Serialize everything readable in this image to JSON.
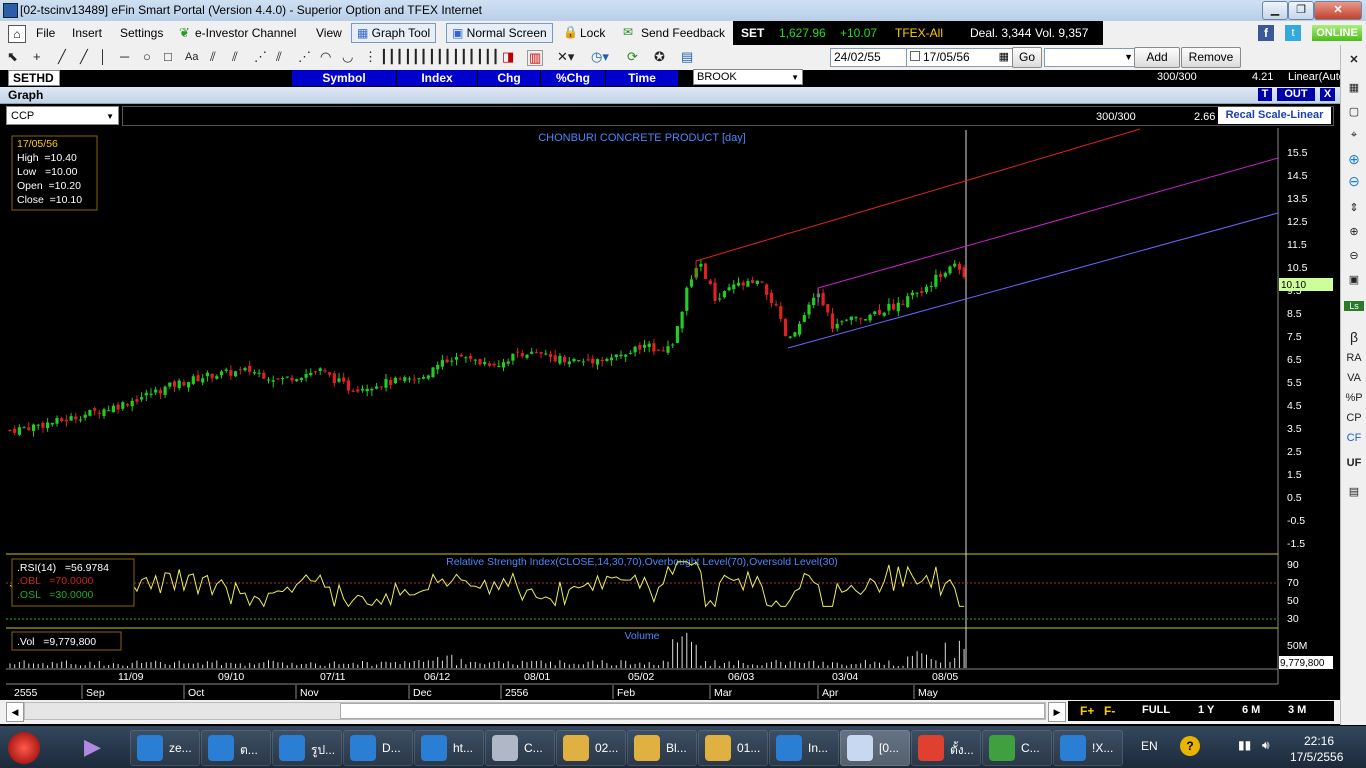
{
  "window": {
    "title": "[02-tscinv13489] eFin Smart Portal (Version 4.4.0) - Superior Option and TFEX Internet"
  },
  "menu": {
    "items": [
      "File",
      "Insert",
      "Settings",
      "e-Investor Channel",
      "View"
    ],
    "graph_tool": "Graph Tool",
    "normal_screen": "Normal Screen",
    "lock": "Lock",
    "send_feedback": "Send Feedback",
    "online": "ONLINE"
  },
  "ticker": {
    "index_name": "SET",
    "index_value": "1,627.96",
    "index_change": "+10.07",
    "tfex": "TFEX-All",
    "deal": "Deal. 3,344",
    "vol": "Vol. 9,357"
  },
  "toolbar": {
    "broker_select": "BROOK",
    "date_from": "24/02/55",
    "date_to": "17/05/56",
    "go": "Go",
    "add": "Add",
    "remove": "Remove",
    "font_icon_label": "Aa"
  },
  "quote_header": {
    "market": "SETHD",
    "columns": [
      "Symbol",
      "Index",
      "Chg",
      "%Chg",
      "Time"
    ],
    "count": "300/300",
    "value": "4.21",
    "scale": "Linear(Auto"
  },
  "graph_panel": {
    "title": "Graph",
    "t_button": "T",
    "out_button": "OUT",
    "close_button": "X",
    "symbol": "CCP",
    "count": "300/300",
    "value": "2.66",
    "recal": "Recal Scale-Linear"
  },
  "price_chart": {
    "title": "CHONBURI CONCRETE PRODUCT [day]",
    "info": {
      "date": "17/05/56",
      "high": "High  =10.40",
      "low": "Low   =10.00",
      "open": "Open  =10.20",
      "close": "Close  =10.10"
    },
    "last_price_tag": "10.10",
    "y_ticks": [
      "15.5",
      "14.5",
      "13.5",
      "12.5",
      "11.5",
      "10.5",
      "9.5",
      "8.5",
      "7.5",
      "6.5",
      "5.5",
      "4.5",
      "3.5",
      "2.5",
      "1.5",
      "0.5",
      "-0.5",
      "-1.5"
    ]
  },
  "rsi_panel": {
    "title": "Relative Strength Index(CLOSE,14,30,70),Overbought Level(70),Oversold Level(30)",
    "rsi": ".RSI(14)   =56.9784",
    "obl": ".OBL   =70.0000",
    "osl": ".OSL   =30.0000",
    "y_ticks": [
      "90",
      "70",
      "50",
      "30"
    ]
  },
  "volume_panel": {
    "title": "Volume",
    "vol": ".Vol   =9,779,800",
    "tag": "9,779,800",
    "y_tick": "50M"
  },
  "x_axis": {
    "dates": [
      "11/09",
      "09/10",
      "07/11",
      "06/12",
      "08/01",
      "05/02",
      "06/03",
      "03/04",
      "08/05"
    ],
    "months": [
      "2555",
      "Sep",
      "Oct",
      "Nov",
      "Dec",
      "2556",
      "Feb",
      "Mar",
      "Apr",
      "May"
    ]
  },
  "range_buttons": {
    "f_plus": "F+",
    "f_minus": "F-",
    "full": "FULL",
    "y1": "1 Y",
    "m6": "6 M",
    "m3": "3 M"
  },
  "sidebar": {
    "labels": [
      "β",
      "RA",
      "VA",
      "%P",
      "CP",
      "CF",
      "UF"
    ]
  },
  "taskbar": {
    "items": [
      "ze...",
      "ต...",
      "รูป...",
      "D...",
      "ht...",
      "C...",
      "02...",
      "Bl...",
      "01...",
      "In...",
      "[0...",
      "ตั้ง...",
      "C...",
      "!X..."
    ],
    "lang": "EN",
    "time": "22:16",
    "date": "17/5/2556"
  },
  "chart_data": {
    "type": "candlestick",
    "title": "CHONBURI CONCRETE PRODUCT [day]",
    "y_range": [
      -1.5,
      15.5
    ],
    "series": [
      {
        "date": "11/09",
        "close": 3.8
      },
      {
        "date": "09/10",
        "close": 5.8
      },
      {
        "date": "07/11",
        "close": 5.5
      },
      {
        "date": "06/12",
        "close": 6.4
      },
      {
        "date": "08/01",
        "close": 6.6
      },
      {
        "date": "05/02",
        "close": 7.0
      },
      {
        "date": "06/03",
        "close": 10.0
      },
      {
        "date": "03/04",
        "close": 8.0
      },
      {
        "date": "08/05",
        "close": 10.2
      },
      {
        "date": "17/05/56",
        "open": 10.2,
        "high": 10.4,
        "low": 10.0,
        "close": 10.1
      }
    ],
    "rsi_last": 56.9784,
    "rsi_levels": [
      30,
      70
    ],
    "volume_last": 9779800
  }
}
